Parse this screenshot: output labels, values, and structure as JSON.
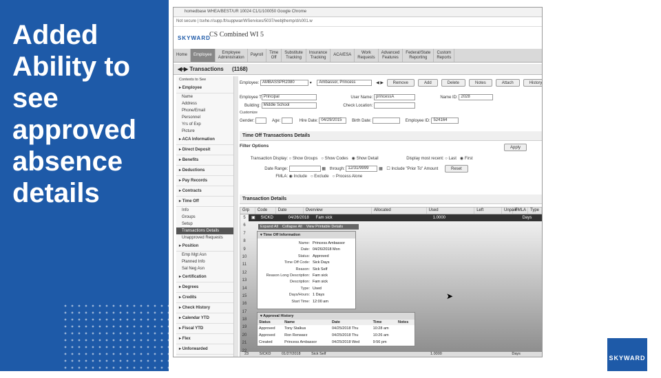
{
  "slide": {
    "title": "Added Ability to see approved absence details"
  },
  "browser": {
    "window_title": "homedbase  WHEA/BEST/UR  10024  C1/1/100050  Google Chrome",
    "address": "Not secure | tsxhe.r/supp.ft/suppwar/WServices/5037/webjthemp/d/s001.w"
  },
  "app": {
    "logo": "SKYWARD",
    "db_name": "CS Combined WI 5"
  },
  "nav": [
    {
      "label": "Home"
    },
    {
      "label": "Employee"
    },
    {
      "label": "Employee\nAdministration"
    },
    {
      "label": "Payroll"
    },
    {
      "label": "Time\nOff"
    },
    {
      "label": "Substitute\nTracking"
    },
    {
      "label": "Insurance\nTracking"
    },
    {
      "label": "ACA/ESA"
    },
    {
      "label": "Work\nRequests"
    },
    {
      "label": "Advanced\nFeatures"
    },
    {
      "label": "Federal/State\nReporting"
    },
    {
      "label": "Custom\nReports"
    }
  ],
  "screen": {
    "title": "Transactions",
    "count": "(1168)"
  },
  "sidebar": {
    "context_label": "Contexts to See",
    "items": [
      {
        "label": "Employee",
        "type": "group"
      },
      {
        "label": "Name",
        "type": "item"
      },
      {
        "label": "Address",
        "type": "item"
      },
      {
        "label": "Phone/Email",
        "type": "item"
      },
      {
        "label": "Personnel",
        "type": "item"
      },
      {
        "label": "Yrs of Exp",
        "type": "item"
      },
      {
        "label": "Picture",
        "type": "item"
      },
      {
        "label": "ACA Information",
        "type": "group"
      },
      {
        "label": "Direct Deposit",
        "type": "group"
      },
      {
        "label": "Benefits",
        "type": "group"
      },
      {
        "label": "Deductions",
        "type": "group"
      },
      {
        "label": "Pay Records",
        "type": "group"
      },
      {
        "label": "Contracts",
        "type": "group"
      },
      {
        "label": "Time Off",
        "type": "group"
      },
      {
        "label": "Info",
        "type": "item"
      },
      {
        "label": "Groups",
        "type": "item"
      },
      {
        "label": "Setup",
        "type": "item"
      },
      {
        "label": "Transactions Details",
        "type": "selected"
      },
      {
        "label": "Unapproved Requests",
        "type": "item"
      },
      {
        "label": "Position",
        "type": "group"
      },
      {
        "label": "Emp Mgt Asn",
        "type": "item"
      },
      {
        "label": "Planned Info",
        "type": "item"
      },
      {
        "label": "Sal Neg Asn",
        "type": "item"
      },
      {
        "label": "Certification",
        "type": "group"
      },
      {
        "label": "Degrees",
        "type": "group"
      },
      {
        "label": "Credits",
        "type": "group"
      },
      {
        "label": "Check History",
        "type": "group"
      },
      {
        "label": "Calendar YTD",
        "type": "group"
      },
      {
        "label": "Fiscal YTD",
        "type": "group"
      },
      {
        "label": "Flex",
        "type": "group"
      },
      {
        "label": "Unforwarded",
        "type": "group"
      }
    ]
  },
  "employee_bar": {
    "label": "Employee:",
    "value": "AMBASSPR2080",
    "name": "Ambassor, Princess",
    "buttons": [
      "Remove",
      "Add",
      "Delete",
      "Notes",
      "Attach",
      "History"
    ]
  },
  "employee_info": {
    "type_label": "Employee Type:",
    "type_value": "Principal",
    "building_label": "Building:",
    "building_value": "Middle School",
    "user_name_label": "User Name:",
    "user_name_value": "princessA",
    "check_location_label": "Check Location:",
    "name_id_label": "Name ID:",
    "name_id_value": "2028",
    "customize_label": "Customize",
    "gender_label": "Gender:",
    "age_label": "Age:",
    "hire_date_label": "Hire Date:",
    "hire_date_value": "04/29/2015",
    "birth_date_label": "Birth Date:",
    "employee_id_label": "Employee ID:",
    "employee_id_value": "524164"
  },
  "details_title": "Time Off Transactions Details",
  "filter": {
    "title": "Filter Options",
    "apply": "Apply",
    "display_label": "Transaction Display:",
    "display_options": [
      "Show Groups",
      "Show Codes",
      "Show Detail"
    ],
    "recent_label": "Display most recent:",
    "recent_options": [
      "Last",
      "First"
    ],
    "date_range_label": "Date Range:",
    "through_label": "through:",
    "through_value": "12/31/9999",
    "include_label": "Include \"Prior To\" Amount",
    "reset": "Reset",
    "fmla_label": "FMLA:",
    "fmla_options": [
      "Include",
      "Exclude",
      "Process Alone"
    ]
  },
  "transactions": {
    "title": "Transaction Details",
    "columns": [
      "Grp",
      "Code",
      "Date",
      "Overview",
      "Allocated",
      "Used",
      "Left",
      "Unpaid",
      "FMLA",
      "Type"
    ],
    "selected_row": {
      "code": "SICKD",
      "date": "04/26/2018",
      "overview": "Fam sick",
      "used": "1.0000",
      "type": "Days"
    },
    "row_numbers": [
      "5",
      "6",
      "7",
      "8",
      "9",
      "10",
      "11",
      "12",
      "13",
      "14",
      "15",
      "16",
      "17",
      "18",
      "19",
      "20",
      "21",
      "22"
    ],
    "expander_links": [
      "Expand All",
      "Collapse All",
      "View Printable Details"
    ]
  },
  "time_off_info": {
    "title": "Time Off Information",
    "fields": [
      {
        "k": "Name:",
        "v": "Princess Ambassor"
      },
      {
        "k": "Date:",
        "v": "04/26/2018 Mon"
      },
      {
        "k": "Status:",
        "v": "Approved"
      },
      {
        "k": "Time Off Code:",
        "v": "Sick Days"
      },
      {
        "k": "Reason:",
        "v": "Sick Self"
      },
      {
        "k": "Reason Long Description:",
        "v": "Fam sick"
      },
      {
        "k": "Description:",
        "v": "Fam sick"
      },
      {
        "k": "Type:",
        "v": "Used"
      },
      {
        "k": "Days/Hours:",
        "v": "1 Days"
      },
      {
        "k": "Start Time:",
        "v": "12:00 am"
      }
    ]
  },
  "approval": {
    "title": "Approval History",
    "columns": [
      "Status",
      "Name",
      "Date",
      "Time",
      "Notes"
    ],
    "rows": [
      {
        "status": "Approved",
        "name": "Tony Stalkus",
        "date": "04/25/2018 Thu",
        "time": "10:28 am"
      },
      {
        "status": "Approved",
        "name": "Ron Renwarz",
        "date": "04/25/2018 Thu",
        "time": "10:26 am"
      },
      {
        "status": "Created",
        "name": "Princess Ambassor",
        "date": "04/25/2018 Wed",
        "time": "9:56 pm"
      }
    ]
  },
  "bottom_row": {
    "num": "23",
    "code": "SICKD",
    "date": "01/27/2018",
    "overview": "Sick Self",
    "used": "1.0000",
    "type": "Days"
  },
  "footer_logo": "SKYWARD",
  "colors": {
    "brand_blue": "#1e5aa8",
    "selected_row": "#333333"
  }
}
